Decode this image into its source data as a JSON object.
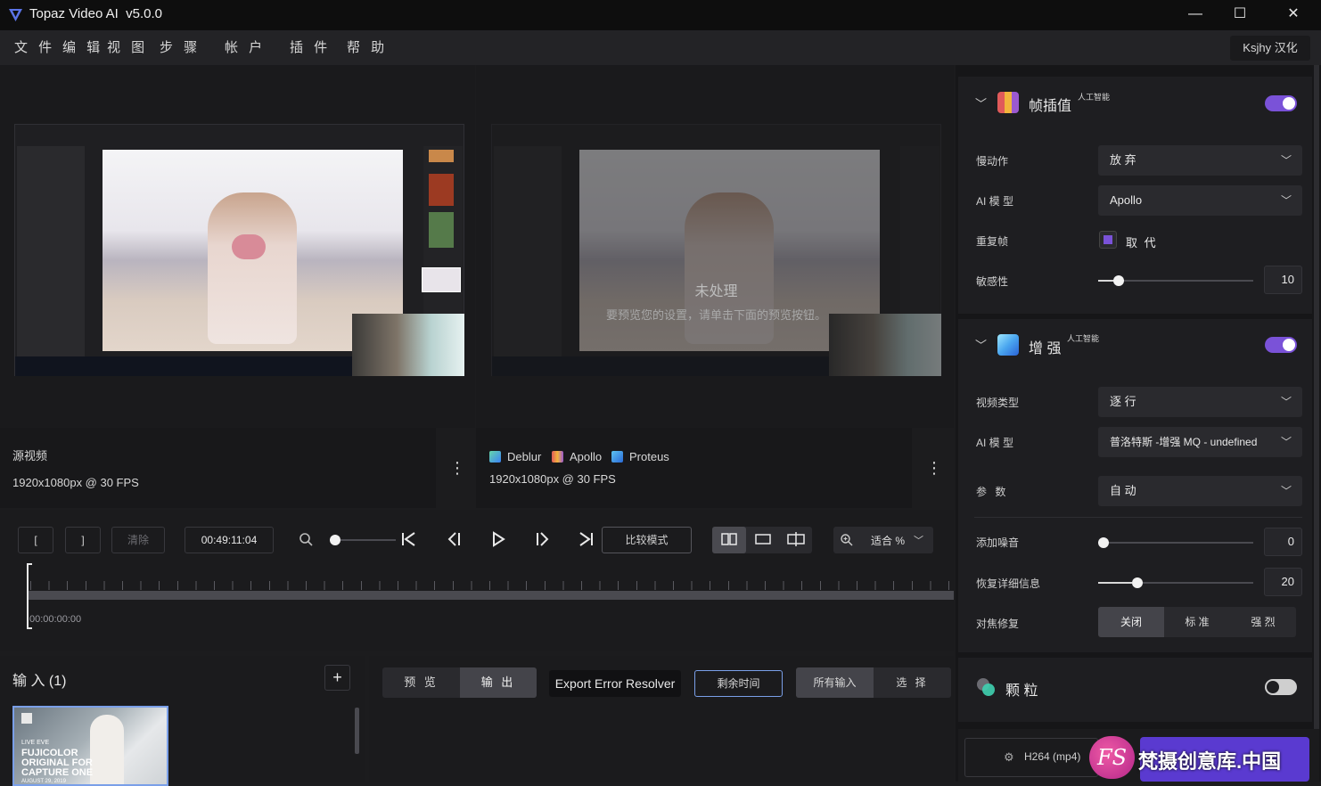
{
  "app": {
    "title": "Topaz Video AI  v5.0.0"
  },
  "window_controls": {
    "minimize": "—",
    "maximize": "☐",
    "close": "✕"
  },
  "menu": [
    "文 件",
    "编 辑",
    "视 图",
    "步 骤",
    "帐 户",
    "插 件",
    "帮 助"
  ],
  "account_button": "Ksjhy 汉化",
  "preview": {
    "left_overlay": "",
    "right_overlay_title": "未处理",
    "right_overlay_text": "要预览您的设置，请单击下面的预览按钮。"
  },
  "source_info": {
    "title": "源视频",
    "resolution": "1920x1080px @ 30 FPS"
  },
  "output_info": {
    "models": [
      "Deblur",
      "Apollo",
      "Proteus"
    ],
    "resolution": "1920x1080px @ 30 FPS"
  },
  "transport": {
    "in_mark": "[",
    "out_mark": "]",
    "clear": "清除",
    "timecode": "00:49:11:04",
    "compare_mode": "比较模式",
    "zoom_label": "适合 %",
    "timeline_start": "00:00:00:00"
  },
  "inputs": {
    "title": "输 入 (1)",
    "add": "+",
    "thumb_lines": [
      "FUJICOLOR",
      "ORIGINAL FOR",
      "CAPTURE ONE"
    ],
    "thumb_small": "LIVE EVE",
    "thumb_date": "AUGUST 29, 2019"
  },
  "output_tabs": {
    "preview": "预 览",
    "output": "输 出",
    "export_error": "Export Error Resolver",
    "remaining": "剩余时间",
    "all_inputs": "所有输入",
    "select": "选 择"
  },
  "frame_interp": {
    "title": "帧插值",
    "ai_tag": "人工智能",
    "enabled": true,
    "slow_motion_label": "慢动作",
    "slow_motion_value": "放 弃",
    "ai_model_label": "AI 模 型",
    "ai_model_value": "Apollo",
    "dup_frames_label": "重复帧",
    "dup_frames_value": "取 代",
    "sensitivity_label": "敏感性",
    "sensitivity_value": "10",
    "sensitivity_fraction": 0.1
  },
  "enhance": {
    "title": "增 强",
    "ai_tag": "人工智能",
    "enabled": true,
    "video_type_label": "视频类型",
    "video_type_value": "逐 行",
    "ai_model_label": "AI 模 型",
    "ai_model_value": "普洛特斯 -增强 MQ - undefined",
    "params_label": "参 数",
    "params_value": "自 动",
    "noise_label": "添加噪音",
    "noise_value": "0",
    "noise_fraction": 0.0,
    "detail_label": "恢复详细信息",
    "detail_value": "20",
    "detail_fraction": 0.22,
    "focus_label": "对焦修复",
    "focus_options": [
      "关闭",
      "标 准",
      "强 烈"
    ],
    "focus_selected": "关闭"
  },
  "grain": {
    "title": "颗 粒",
    "enabled": false
  },
  "export": {
    "format": "H264 (mp4)"
  },
  "watermark": {
    "text": "梵摄创意库.中国",
    "logo": "FS"
  },
  "colors": {
    "accent": "#7a52d8",
    "toggle_off": "#cfcfcf"
  }
}
